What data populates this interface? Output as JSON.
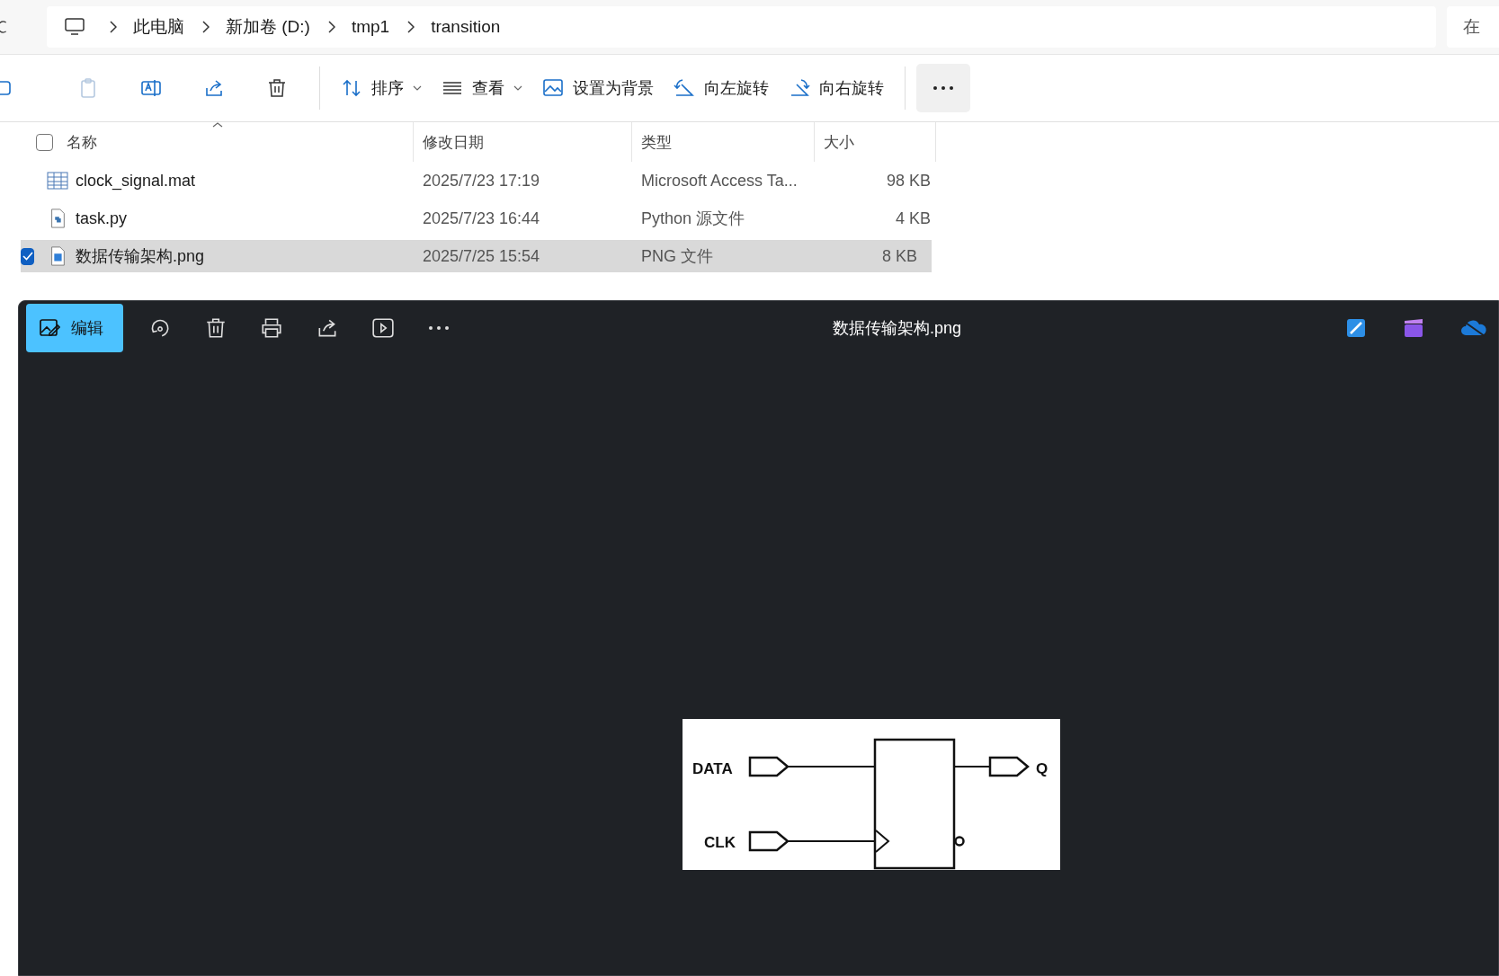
{
  "address_bar": {
    "crumbs": [
      "此电脑",
      "新加卷 (D:)",
      "tmp1",
      "transition"
    ],
    "search_placeholder": "在"
  },
  "toolbar": {
    "buttons": [
      {
        "label": "排序",
        "dropdown": true
      },
      {
        "label": "查看",
        "dropdown": true
      },
      {
        "label": "设置为背景",
        "dropdown": false
      },
      {
        "label": "向左旋转",
        "dropdown": false
      },
      {
        "label": "向右旋转",
        "dropdown": false
      }
    ]
  },
  "file_list": {
    "select_all_checked": false,
    "columns": [
      "名称",
      "修改日期",
      "类型",
      "大小"
    ],
    "rows": [
      {
        "kind": "table",
        "name": "clock_signal.mat",
        "date": "2025/7/23 17:19",
        "type": "Microsoft Access Ta...",
        "size": "98 KB",
        "selected": false
      },
      {
        "kind": "python",
        "name": "task.py",
        "date": "2025/7/23 16:44",
        "type": "Python 源文件",
        "size": "4 KB",
        "selected": false
      },
      {
        "kind": "image",
        "name": "数据传输架构.png",
        "date": "2025/7/25 15:54",
        "type": "PNG 文件",
        "size": "8 KB",
        "selected": true
      }
    ]
  },
  "viewer": {
    "edit_label": "编辑",
    "title": "数据传输架构.png",
    "diagram": {
      "inputs": [
        "DATA",
        "CLK"
      ],
      "output": "Q"
    }
  }
}
